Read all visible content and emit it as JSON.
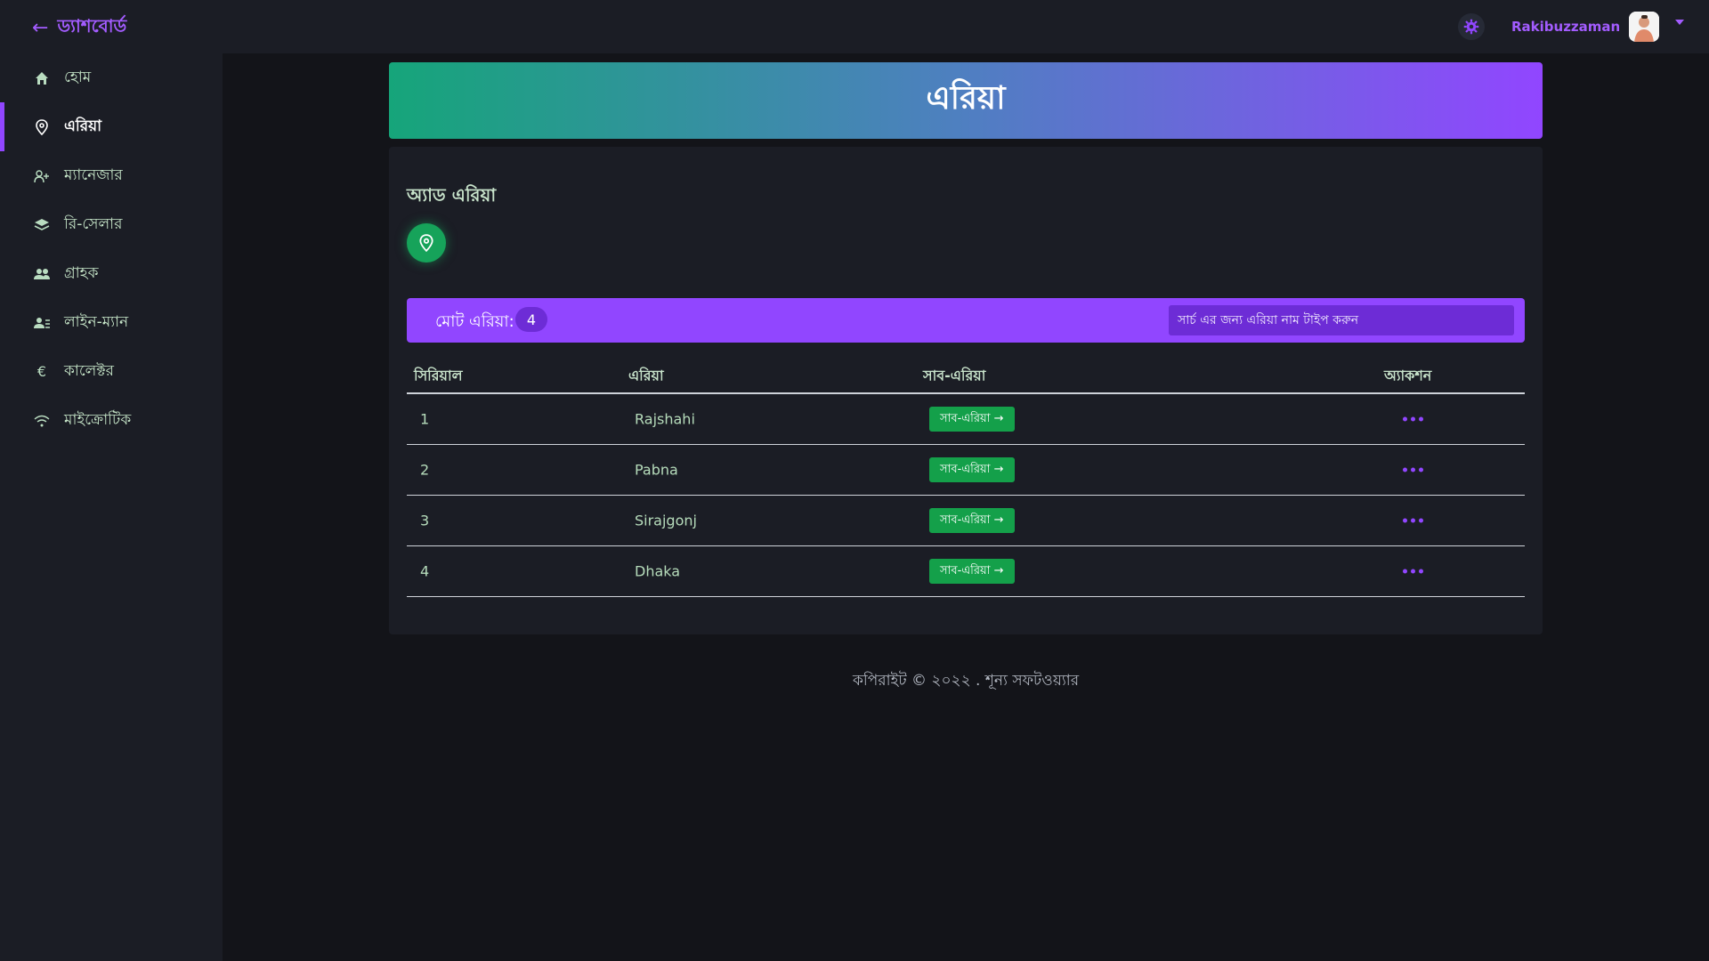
{
  "topbar": {
    "brand": "ড্যাশবোর্ড",
    "back_icon": "arrow-left-icon",
    "settings_icon": "gear-icon",
    "user_name": "Rakibuzzaman",
    "accent": "#9146ff"
  },
  "sidebar": {
    "items": [
      {
        "label": "হোম",
        "icon": "home-icon",
        "active": false
      },
      {
        "label": "এরিয়া",
        "icon": "map-pin-icon",
        "active": true
      },
      {
        "label": "ম্যানেজার",
        "icon": "user-plus-icon",
        "active": false
      },
      {
        "label": "রি-সেলার",
        "icon": "layers-icon",
        "active": false
      },
      {
        "label": "গ্রাহক",
        "icon": "users-icon",
        "active": false
      },
      {
        "label": "লাইন-ম্যান",
        "icon": "user-list-icon",
        "active": false
      },
      {
        "label": "কালেক্টর",
        "icon": "euro-icon",
        "active": false
      },
      {
        "label": "মাইক্রোটিক",
        "icon": "wifi-icon",
        "active": false
      }
    ]
  },
  "page": {
    "title": "এরিয়া",
    "add_title": "অ্যাড এরিয়া",
    "add_icon": "map-pin-icon"
  },
  "toolbar": {
    "total_label": "মোট এরিয়া:",
    "total_count": "4",
    "search_placeholder": "সার্চ এর জন্য এরিয়া নাম টাইপ করুন"
  },
  "table": {
    "headers": [
      "সিরিয়াল",
      "এরিয়া",
      "সাব-এরিয়া",
      "অ্যাকশন"
    ],
    "rows": [
      {
        "serial": "1",
        "area": "Rajshahi",
        "sub_label": "সাব-এরিয়া →"
      },
      {
        "serial": "2",
        "area": "Pabna",
        "sub_label": "সাব-এরিয়া →"
      },
      {
        "serial": "3",
        "area": "Sirajgonj",
        "sub_label": "সাব-এরিয়া →"
      },
      {
        "serial": "4",
        "area": "Dhaka",
        "sub_label": "সাব-এরিয়া →"
      }
    ]
  },
  "footer": {
    "text": "কপিরাইট © ২০২২ . শূন্য সফটওয়্যার"
  }
}
